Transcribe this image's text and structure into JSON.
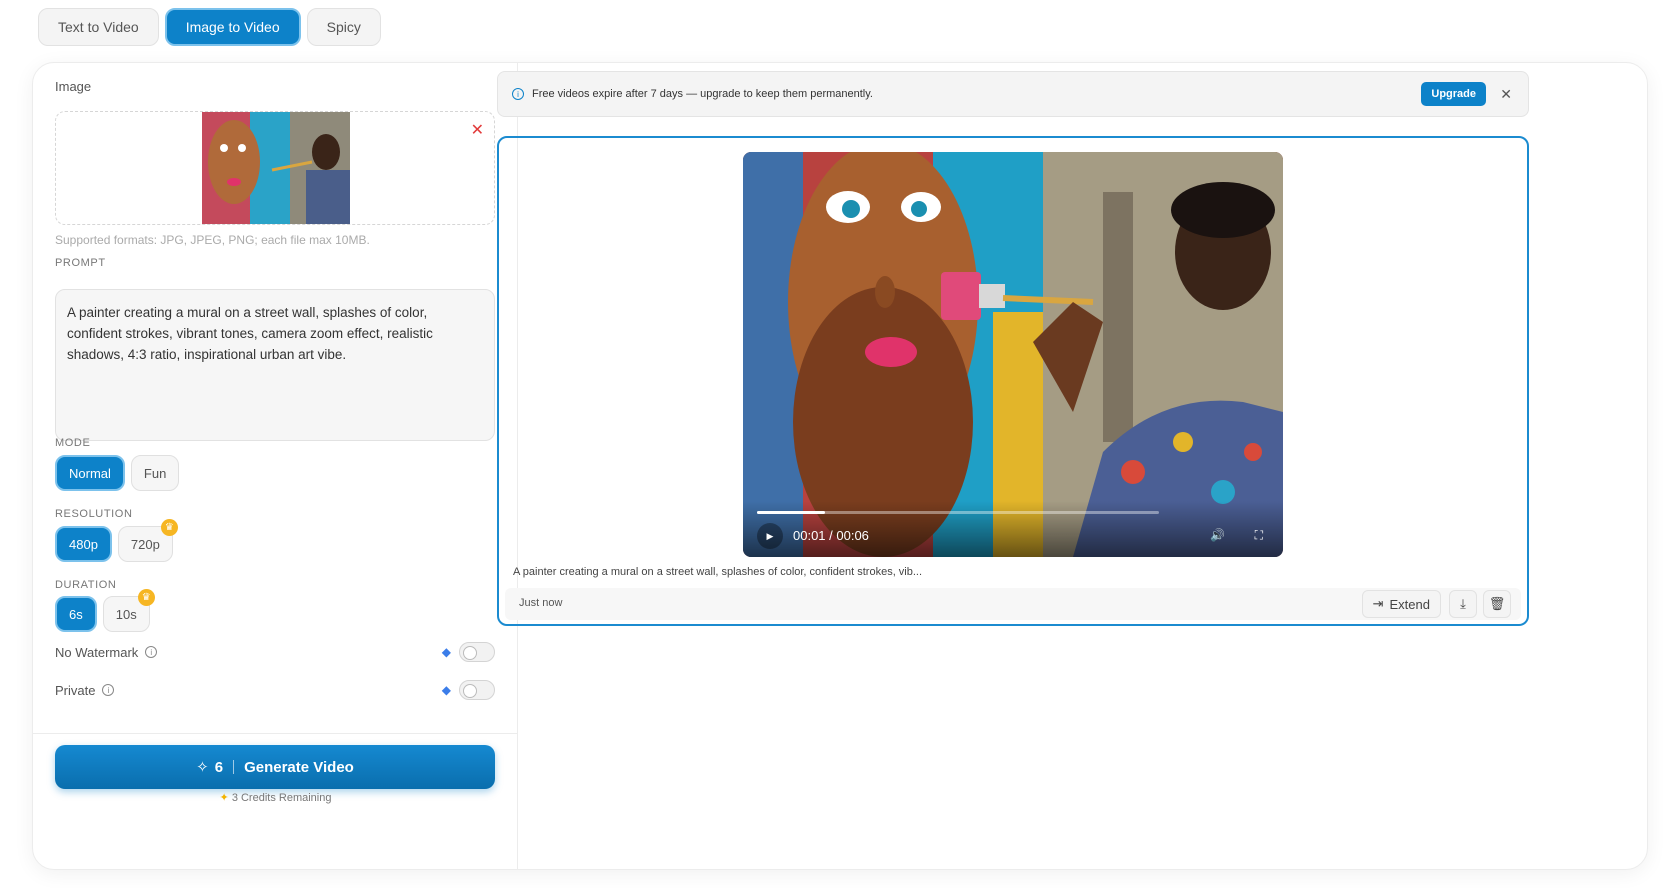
{
  "tabs": [
    {
      "label": "Text to Video",
      "active": false
    },
    {
      "label": "Image to Video",
      "active": true
    },
    {
      "label": "Spicy",
      "active": false
    }
  ],
  "image": {
    "label": "Image",
    "hint": "Supported formats: JPG, JPEG, PNG; each file max 10MB.",
    "remove_icon": "close-icon"
  },
  "prompt": {
    "label": "PROMPT",
    "value": "A painter creating a mural on a street wall, splashes of color, confident strokes, vibrant tones, camera zoom effect, realistic shadows, 4:3 ratio, inspirational urban art vibe."
  },
  "mode": {
    "label": "MODE",
    "options": [
      "Normal",
      "Fun"
    ],
    "selected": "Normal"
  },
  "resolution": {
    "label": "RESOLUTION",
    "options": [
      "480p",
      "720p"
    ],
    "selected": "480p"
  },
  "duration": {
    "label": "DURATION",
    "options": [
      "6s",
      "10s"
    ],
    "selected": "6s"
  },
  "watermark": {
    "label": "No Watermark",
    "enabled": false
  },
  "private": {
    "label": "Private",
    "enabled": false
  },
  "generate": {
    "cost": "6",
    "label": "Generate Video"
  },
  "credits": {
    "text": "3 Credits Remaining"
  },
  "notice": {
    "text": "Free videos expire after 7 days — upgrade to keep them permanently.",
    "upgrade_label": "Upgrade"
  },
  "result": {
    "time": "00:01 / 00:06",
    "progress": 0.17,
    "caption": "A painter creating a mural on a street wall, splashes of color, confident strokes, vib...",
    "created": "Just now",
    "extend_label": "Extend"
  },
  "colors": {
    "accent": "#0d82c9",
    "crown": "#f6b623",
    "remove": "#e23b3b"
  }
}
